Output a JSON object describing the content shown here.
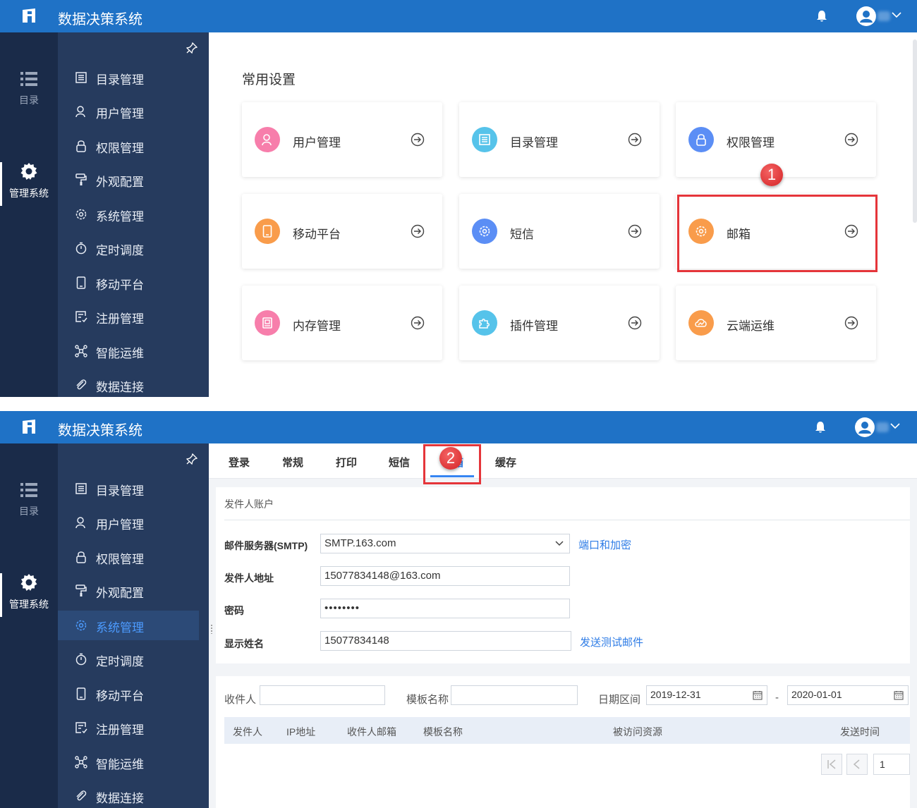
{
  "header": {
    "app_title": "数据决策系统"
  },
  "rail": {
    "catalog_label": "目录",
    "admin_label": "管理系统"
  },
  "sidebar": {
    "items": [
      {
        "label": "目录管理",
        "icon": "list-icon"
      },
      {
        "label": "用户管理",
        "icon": "user-icon"
      },
      {
        "label": "权限管理",
        "icon": "lock-icon"
      },
      {
        "label": "外观配置",
        "icon": "paint-roller-icon"
      },
      {
        "label": "系统管理",
        "icon": "gear-icon"
      },
      {
        "label": "定时调度",
        "icon": "stopwatch-icon"
      },
      {
        "label": "移动平台",
        "icon": "mobile-icon"
      },
      {
        "label": "注册管理",
        "icon": "register-icon"
      },
      {
        "label": "智能运维",
        "icon": "network-icon"
      },
      {
        "label": "数据连接",
        "icon": "link-icon"
      }
    ]
  },
  "panel1": {
    "section_title": "常用设置",
    "cards": [
      {
        "label": "用户管理",
        "color": "#f77eab"
      },
      {
        "label": "目录管理",
        "color": "#56c3ea"
      },
      {
        "label": "权限管理",
        "color": "#5b8ef5"
      },
      {
        "label": "移动平台",
        "color": "#f99c4b"
      },
      {
        "label": "短信",
        "color": "#5b8ef5"
      },
      {
        "label": "邮箱",
        "color": "#f99c4b"
      },
      {
        "label": "内存管理",
        "color": "#f77eab"
      },
      {
        "label": "插件管理",
        "color": "#56c3ea"
      },
      {
        "label": "云端运维",
        "color": "#f99c4b"
      }
    ],
    "marker": "1"
  },
  "panel2": {
    "marker": "2",
    "tabs": [
      "登录",
      "常规",
      "打印",
      "短信",
      "邮箱",
      "缓存"
    ],
    "active_tab": "邮箱",
    "form": {
      "section": "发件人账户",
      "smtp_label": "邮件服务器(SMTP)",
      "smtp_value": "SMTP.163.com",
      "port_link": "端口和加密",
      "sender_label": "发件人地址",
      "sender_value": "15077834148@163.com",
      "password_label": "密码",
      "password_value": "••••••••",
      "display_label": "显示姓名",
      "display_value": "15077834148",
      "test_link": "发送测试邮件"
    },
    "log": {
      "recipient_label": "收件人",
      "template_label": "模板名称",
      "date_label": "日期区间",
      "date_from": "2019-12-31",
      "date_sep": "-",
      "date_to": "2020-01-01",
      "columns": [
        "发件人",
        "IP地址",
        "收件人邮箱",
        "模板名称",
        "被访问资源",
        "发送时间"
      ],
      "page": "1"
    }
  },
  "colors": {
    "topbar": "#1f72c6",
    "rail": "#1a2b49",
    "sidebar": "#263b5e",
    "accent": "#3685f2",
    "highlight": "#e5353a"
  }
}
